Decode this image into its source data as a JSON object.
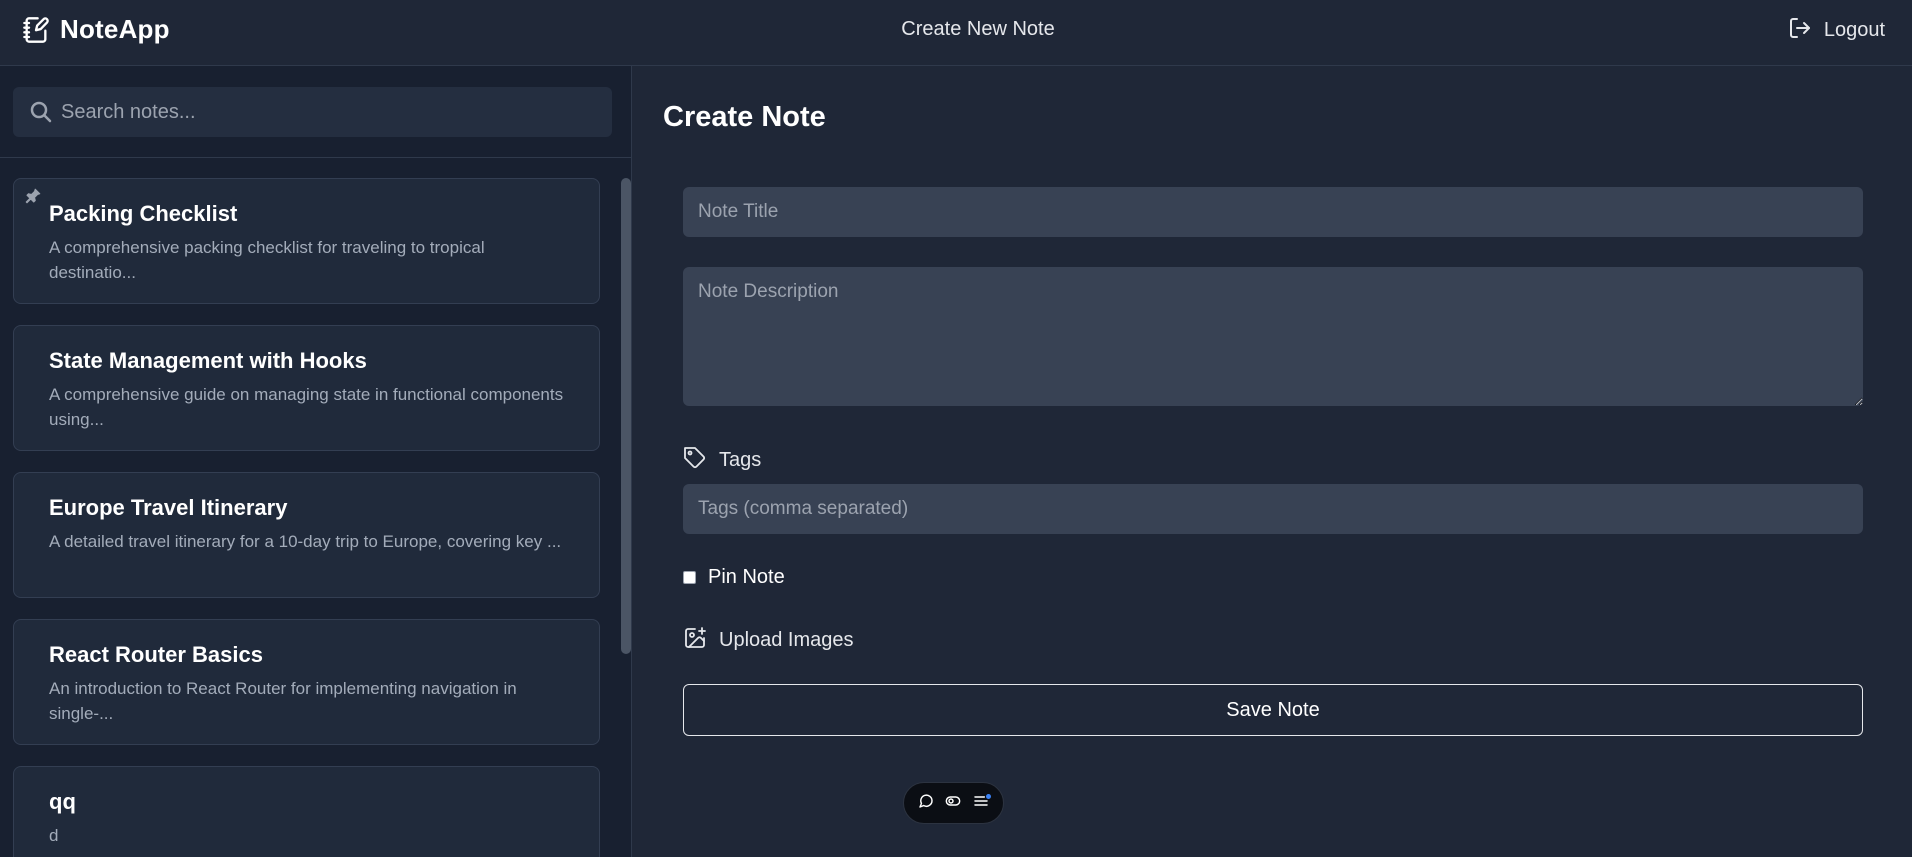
{
  "app": {
    "name": "NoteApp",
    "page_heading": "Create New Note",
    "logout_label": "Logout"
  },
  "sidebar": {
    "search": {
      "placeholder": "Search notes...",
      "value": ""
    },
    "notes": [
      {
        "title": "Packing Checklist",
        "description": "A comprehensive packing checklist for traveling to tropical destinatio...",
        "pinned": true
      },
      {
        "title": "State Management with Hooks",
        "description": "A comprehensive guide on managing state in functional components using...",
        "pinned": false
      },
      {
        "title": "Europe Travel Itinerary",
        "description": "A detailed travel itinerary for a 10-day trip to Europe, covering key ...",
        "pinned": false
      },
      {
        "title": "React Router Basics",
        "description": "An introduction to React Router for implementing navigation in single-...",
        "pinned": false
      },
      {
        "title": "qq",
        "description": "d",
        "pinned": false
      }
    ]
  },
  "form": {
    "title": "Create Note",
    "note_title_placeholder": "Note Title",
    "note_description_placeholder": "Note Description",
    "tags_label": "Tags",
    "tags_placeholder": "Tags (comma separated)",
    "pin_label": "Pin Note",
    "pin_checked": false,
    "upload_label": "Upload Images",
    "save_label": "Save Note"
  },
  "colors": {
    "background": "#1f2737",
    "sidebar": "#182030",
    "card": "#202a3b",
    "input": "#384254",
    "accent_dot": "#3b82f6"
  },
  "icons": {
    "brand": "notebook-pen-icon",
    "logout": "logout-icon",
    "search": "search-icon",
    "pin": "pin-icon",
    "tags": "tag-icon",
    "upload": "image-plus-icon",
    "toolbar": [
      "chat-bubble-icon",
      "toggle-icon",
      "menu-icon"
    ]
  }
}
